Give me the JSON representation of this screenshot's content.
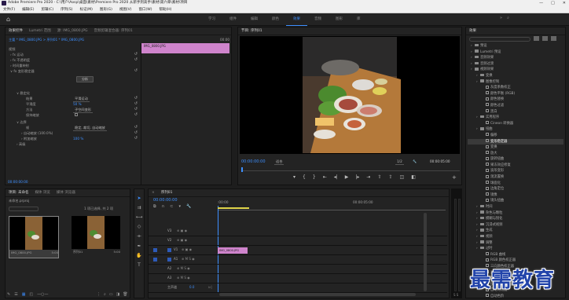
{
  "window": {
    "title": "Adobe Premiere Pro 2020 - C:\\用户\\Aosp\\桌面\\素材\\Premiere Pro 2020 从新手到高手\\素材\\第六章\\素材\\项目",
    "controls": [
      "—",
      "□",
      "✕"
    ]
  },
  "menu": [
    "文件(F)",
    "编辑(E)",
    "剪辑(C)",
    "序列(S)",
    "标记(M)",
    "图形(G)",
    "视图(V)",
    "窗口(W)",
    "帮助(H)"
  ],
  "workspaces": {
    "tabs": [
      "学习",
      "组件",
      "编辑",
      "颜色",
      "效果",
      "音频",
      "图形",
      "库"
    ],
    "active": "效果"
  },
  "effect_controls": {
    "tabs": [
      "效果控件",
      "Lumetri 范围",
      "源: IMG_0800.JPG",
      "音频剪辑混合器: 序列01"
    ],
    "active_tab": "效果控件",
    "clip_line": "主要 * IMG_0800.JPG  >  序列01 * IMG_0800.JPG",
    "time_right": "00:00",
    "clip_badge": "IMG_0800.JPG",
    "section_video": "视频",
    "rows": [
      "fx 运动",
      "fx 不透明度",
      "时间重映射",
      "fx 变形稳定器"
    ],
    "analyze_btn": "分析",
    "sub_section": "稳定化",
    "params": [
      {
        "label": "结果",
        "value": "平滑运动"
      },
      {
        "label": "平滑度",
        "value": "50 %"
      },
      {
        "label": "方法",
        "value": "子空间变形"
      },
      {
        "label": "保持缩放",
        "value": ""
      }
    ],
    "borders_section": "边界",
    "border_params": [
      {
        "label": "帧",
        "value": "稳定, 裁切, 自动缩放"
      },
      {
        "label": "自动缩放 (100.0%)",
        "value": ""
      },
      {
        "label": "附加缩放",
        "value": "100 %"
      }
    ],
    "advanced": "高级",
    "bottom_time": "00:00:00:00"
  },
  "program_monitor": {
    "title": "节目: 序列01",
    "timecode": "00:00:00:00",
    "fit": "适合",
    "quality": "1/2",
    "duration": "00:00:05:00"
  },
  "project": {
    "tabs": [
      "项目: 未命名",
      "媒体浏览器",
      "库",
      "信息",
      "效果",
      "标记",
      "历史记录"
    ],
    "shown_tabs": [
      "项目: 未命名",
      "媒体 浏览",
      "媒体 浏览器"
    ],
    "project_file": "未命名.prproj",
    "selection": "1 项已选择, 共 2 项",
    "items": [
      {
        "name": "IMG_0800.JPG",
        "duration": "5:00"
      },
      {
        "name": "序列01",
        "duration": "5:00"
      }
    ]
  },
  "timeline": {
    "title": "序列01",
    "timecode": "00:00:00:00",
    "ruler_start": ":00:00",
    "ruler_mark": "00:00:05:00",
    "tracks": [
      {
        "name": "V3",
        "type": "video"
      },
      {
        "name": "V2",
        "type": "video"
      },
      {
        "name": "V1",
        "type": "video"
      },
      {
        "name": "A1",
        "type": "audio"
      },
      {
        "name": "A2",
        "type": "audio"
      },
      {
        "name": "A3",
        "type": "audio"
      }
    ],
    "master": "主声道",
    "master_value": "0.0",
    "clip": "IMG_0800.JPG"
  },
  "effects_panel": {
    "title": "效果",
    "tree": [
      {
        "label": "预设",
        "indent": 0,
        "kind": "folder"
      },
      {
        "label": "Lumetri 预设",
        "indent": 0,
        "kind": "folder"
      },
      {
        "label": "音频效果",
        "indent": 0,
        "kind": "folder"
      },
      {
        "label": "音频过渡",
        "indent": 0,
        "kind": "folder"
      },
      {
        "label": "视频效果",
        "indent": 0,
        "kind": "folder"
      },
      {
        "label": "变换",
        "indent": 1,
        "kind": "folder"
      },
      {
        "label": "图像控制",
        "indent": 1,
        "kind": "folder"
      },
      {
        "label": "灰度系数校正",
        "indent": 2,
        "kind": "fx"
      },
      {
        "label": "颜色平衡 (RGB)",
        "indent": 2,
        "kind": "fx"
      },
      {
        "label": "颜色替换",
        "indent": 2,
        "kind": "fx"
      },
      {
        "label": "颜色过滤",
        "indent": 2,
        "kind": "fx"
      },
      {
        "label": "黑白",
        "indent": 2,
        "kind": "fx"
      },
      {
        "label": "实用程序",
        "indent": 1,
        "kind": "folder"
      },
      {
        "label": "Cineon 转换器",
        "indent": 2,
        "kind": "fx"
      },
      {
        "label": "扭曲",
        "indent": 1,
        "kind": "folder"
      },
      {
        "label": "偏移",
        "indent": 2,
        "kind": "fx"
      },
      {
        "label": "变形稳定器",
        "indent": 2,
        "kind": "fx",
        "selected": true
      },
      {
        "label": "变换",
        "indent": 2,
        "kind": "fx"
      },
      {
        "label": "放大",
        "indent": 2,
        "kind": "fx"
      },
      {
        "label": "旋转扭曲",
        "indent": 2,
        "kind": "fx"
      },
      {
        "label": "果冻效应修复",
        "indent": 2,
        "kind": "fx"
      },
      {
        "label": "波形变形",
        "indent": 2,
        "kind": "fx"
      },
      {
        "label": "湍流置换",
        "indent": 2,
        "kind": "fx"
      },
      {
        "label": "球面化",
        "indent": 2,
        "kind": "fx"
      },
      {
        "label": "边角定位",
        "indent": 2,
        "kind": "fx"
      },
      {
        "label": "镜像",
        "indent": 2,
        "kind": "fx"
      },
      {
        "label": "镜头扭曲",
        "indent": 2,
        "kind": "fx"
      },
      {
        "label": "时间",
        "indent": 1,
        "kind": "folder"
      },
      {
        "label": "杂色与颗粒",
        "indent": 1,
        "kind": "folder"
      },
      {
        "label": "模糊与锐化",
        "indent": 1,
        "kind": "folder"
      },
      {
        "label": "沉浸式视频",
        "indent": 1,
        "kind": "folder"
      },
      {
        "label": "生成",
        "indent": 1,
        "kind": "folder"
      },
      {
        "label": "视频",
        "indent": 1,
        "kind": "folder"
      },
      {
        "label": "调整",
        "indent": 1,
        "kind": "folder"
      },
      {
        "label": "过时",
        "indent": 1,
        "kind": "folder"
      },
      {
        "label": "RGB 曲线",
        "indent": 2,
        "kind": "fx"
      },
      {
        "label": "RGB 颜色校正器",
        "indent": 2,
        "kind": "fx"
      },
      {
        "label": "三向颜色校正器",
        "indent": 2,
        "kind": "fx"
      },
      {
        "label": "亮度曲线",
        "indent": 2,
        "kind": "fx"
      },
      {
        "label": "亮度校正器",
        "indent": 2,
        "kind": "fx"
      },
      {
        "label": "快速颜色校正器",
        "indent": 2,
        "kind": "fx"
      },
      {
        "label": "自动对比度",
        "indent": 2,
        "kind": "fx"
      },
      {
        "label": "自动色阶",
        "indent": 2,
        "kind": "fx"
      }
    ]
  },
  "watermark": "最需教育"
}
